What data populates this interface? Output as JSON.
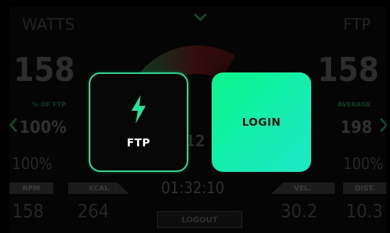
{
  "background": {
    "left_title": "WATTS",
    "right_title": "FTP",
    "left_power": "158",
    "right_power": "158",
    "left_sub_label": "% OF FTP",
    "left_percent": "100%",
    "right_sub_label": "AVERAGE",
    "right_value": "198",
    "left_percent_2": "100%",
    "right_percent_2": "100%",
    "center_value": "12",
    "stats": {
      "rpm_label": "RPM",
      "kcal_label": "KCAL",
      "vel_label": "VEL.",
      "dist_label": "DIST.",
      "rpm_value": "158",
      "kcal_value": "264",
      "vel_value": "30.2",
      "dist_value": "10.3"
    },
    "timer": "01:32:10",
    "logout_label": "LOGOUT"
  },
  "overlay": {
    "ftp_label": "FTP",
    "ftp_icon": "lightning-bolt-icon",
    "login_label": "LOGIN"
  },
  "colors": {
    "accent": "#1fe79a",
    "login_gradient_start": "#0ef58a",
    "login_gradient_end": "#1ee7c8"
  }
}
